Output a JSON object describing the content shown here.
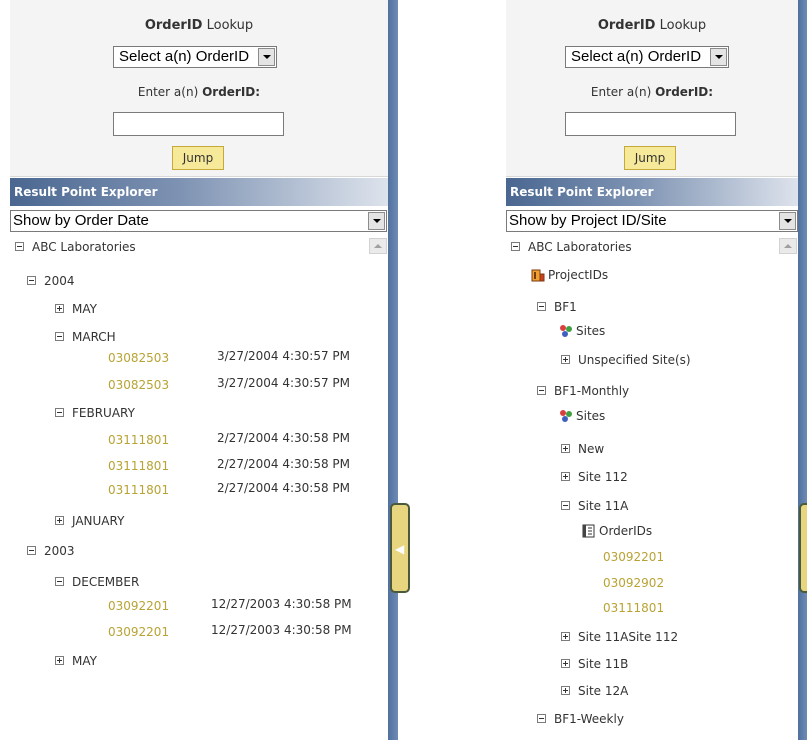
{
  "lookup": {
    "title_bold": "OrderID",
    "title_rest": " Lookup",
    "select_value": "Select a(n) OrderID",
    "enter_label_prefix": "Enter a(n) ",
    "enter_label_bold": "OrderID:",
    "input_value": "",
    "jump_label": "Jump"
  },
  "explorer": {
    "header": "Result Point Explorer"
  },
  "left_panel": {
    "show_by": "Show by Order Date",
    "root": "ABC Laboratories",
    "years": [
      {
        "label": "2004",
        "months": [
          {
            "label": "MAY",
            "expanded": false,
            "orders": []
          },
          {
            "label": "MARCH",
            "expanded": true,
            "orders": [
              {
                "id": "03082503",
                "date": "3/27/2004 4:30:57 PM"
              },
              {
                "id": "03082503",
                "date": "3/27/2004 4:30:57 PM"
              }
            ]
          },
          {
            "label": "FEBRUARY",
            "expanded": true,
            "orders": [
              {
                "id": "03111801",
                "date": "2/27/2004 4:30:58 PM"
              },
              {
                "id": "03111801",
                "date": "2/27/2004 4:30:58 PM"
              },
              {
                "id": "03111801",
                "date": "2/27/2004 4:30:58 PM"
              }
            ]
          },
          {
            "label": "JANUARY",
            "expanded": false,
            "orders": []
          }
        ]
      },
      {
        "label": "2003",
        "months": [
          {
            "label": "DECEMBER",
            "expanded": true,
            "orders": [
              {
                "id": "03092201",
                "date": "12/27/2003 4:30:58 PM"
              },
              {
                "id": "03092201",
                "date": "12/27/2003 4:30:58 PM"
              }
            ]
          },
          {
            "label": "MAY",
            "expanded": false,
            "orders": []
          }
        ]
      }
    ]
  },
  "right_panel": {
    "show_by": "Show by Project ID/Site",
    "root": "ABC Laboratories",
    "projectids_label": "ProjectIDs",
    "bf1": {
      "label": "BF1",
      "sites_label": "Sites",
      "sites": [
        "Unspecified Site(s)"
      ]
    },
    "bf1_monthly": {
      "label": "BF1-Monthly",
      "sites_label": "Sites",
      "sites": [
        "New",
        "Site 112",
        "Site 11A",
        "Site 11ASite 112",
        "Site 11B",
        "Site 12A"
      ],
      "orderids_label": "OrderIDs",
      "orderids": [
        "03092201",
        "03092902",
        "03111801"
      ]
    },
    "bf1_weekly": {
      "label": "BF1-Weekly"
    }
  },
  "colors": {
    "link": "#b8a334",
    "header_start": "#4a6791",
    "jump_bg": "#f6e99a",
    "divider": "#5d7dac"
  },
  "icons": [
    "expand-plus-icon",
    "collapse-minus-icon",
    "dropdown-arrow-icon",
    "scroll-up-arrow-icon",
    "project-ids-icon",
    "sites-icon",
    "order-ids-icon",
    "collapse-arrow-icon"
  ]
}
